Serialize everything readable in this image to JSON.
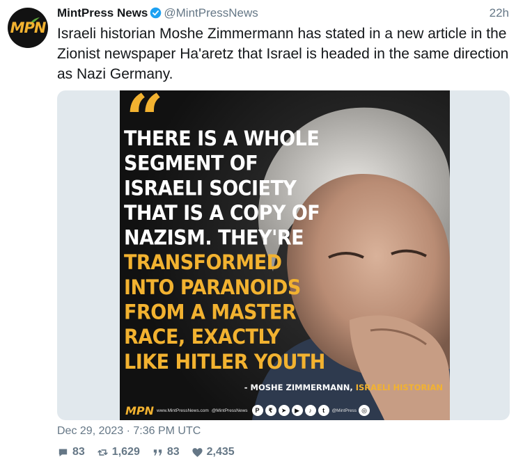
{
  "account": {
    "name": "MintPress News",
    "handle": "@MintPressNews",
    "avatar_text": "MPN",
    "verified": true
  },
  "tweet": {
    "time_ago": "22h",
    "text": "Israeli historian Moshe Zimmermann has stated in a new article in the Zionist newspaper Ha'aretz that Israel is headed in the same direction as Nazi Germany.",
    "timestamp": "Dec 29, 2023 · 7:36 PM UTC"
  },
  "media": {
    "quote_lines": [
      {
        "text": "THERE IS A WHOLE",
        "color": "white"
      },
      {
        "text": "SEGMENT OF",
        "color": "white"
      },
      {
        "text": "ISRAELI SOCIETY",
        "color": "white"
      },
      {
        "text": "THAT IS A COPY OF",
        "color": "white"
      },
      {
        "text": "NAZISM. THEY'RE",
        "color": "white"
      },
      {
        "text": "TRANSFORMED",
        "color": "gold"
      },
      {
        "text": "INTO PARANOIDS",
        "color": "gold"
      },
      {
        "text": "FROM A MASTER",
        "color": "gold"
      },
      {
        "text": "RACE, EXACTLY",
        "color": "gold"
      },
      {
        "text": "LIKE HITLER YOUTH",
        "color": "gold"
      }
    ],
    "attribution_name": "- MOSHE ZIMMERMANN,",
    "attribution_title": "ISRAELI HISTORIAN",
    "footer_logo": "MPN",
    "footer_site": "www.MintPressNews.com",
    "footer_handle": "@MintPressNews",
    "footer_handle2": "@MintPress",
    "accent_color": "#f2b230"
  },
  "stats": {
    "replies": "83",
    "retweets": "1,629",
    "quotes": "83",
    "likes": "2,435"
  }
}
